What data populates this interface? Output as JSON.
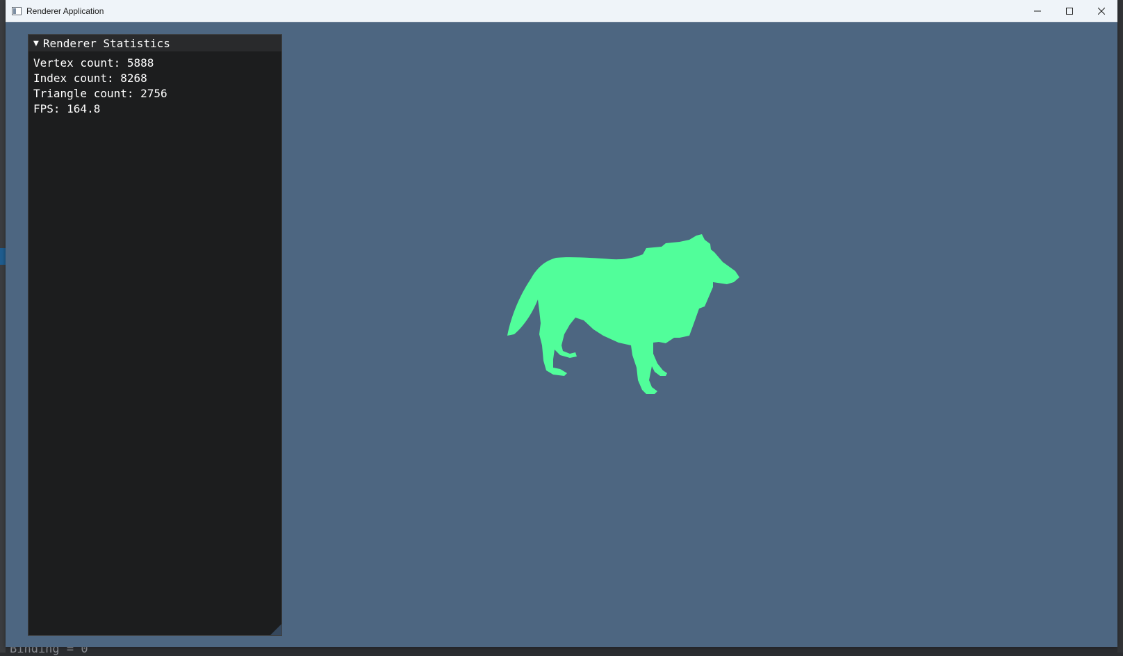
{
  "background": {
    "bottom_code_text": "Binding = 0"
  },
  "window": {
    "title": "Renderer Application",
    "icon": "app-window-icon",
    "controls": [
      "minimize-icon",
      "maximize-icon",
      "close-icon"
    ]
  },
  "panel": {
    "title": "Renderer Statistics",
    "expanded": true,
    "stats": [
      "Vertex count: 5888",
      "Index count: 8268",
      "Triangle count: 2756",
      "FPS: 164.8"
    ]
  },
  "scene": {
    "model": "wolf",
    "clear_color": "#4d6681",
    "model_color": "#51fe9a"
  }
}
